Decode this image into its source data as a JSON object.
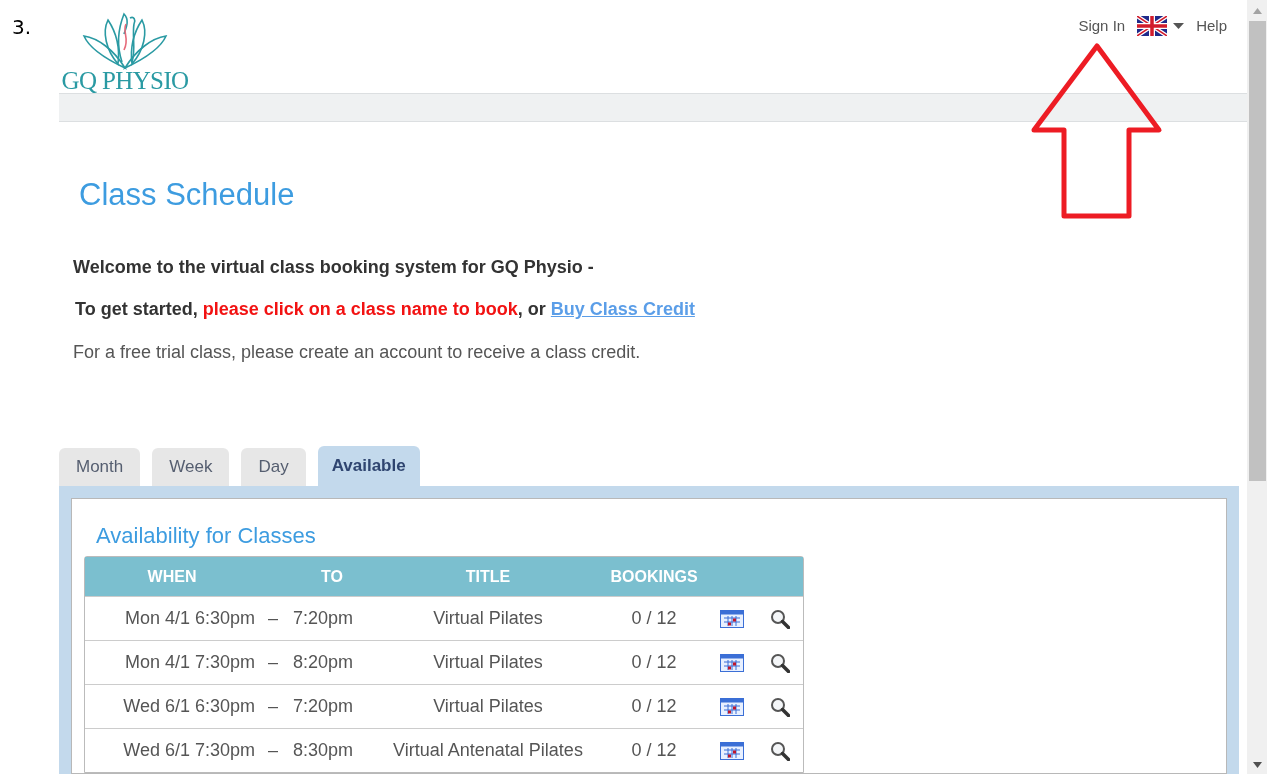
{
  "step_number": "3.",
  "header": {
    "logo_text": "GQ PHYSIO",
    "links": [
      {
        "kind": "link",
        "label": "Sign In"
      },
      {
        "kind": "language"
      },
      {
        "kind": "link",
        "label": "Help"
      }
    ]
  },
  "page_title": "Class Schedule",
  "welcome": "Welcome to the virtual class booking system for GQ Physio -",
  "instructions": {
    "prefix": "To get started, ",
    "highlight": "please click on a class name to book",
    "suffix": ", or ",
    "link": "Buy Class Credit"
  },
  "trial_note": "For a free trial class, please create an account to receive a class credit.",
  "tabs": [
    {
      "label": "Month",
      "selected": false
    },
    {
      "label": "Week",
      "selected": false
    },
    {
      "label": "Day",
      "selected": false
    },
    {
      "label": "Available",
      "selected": true
    }
  ],
  "panel_title": "Availability for Classes",
  "table": {
    "columns": [
      "WHEN",
      "TO",
      "TITLE",
      "BOOKINGS"
    ],
    "rows": [
      {
        "when": "Mon 4/1 6:30pm",
        "separator": "–",
        "to": "7:20pm",
        "title": "Virtual Pilates",
        "bookings": "0 / 12"
      },
      {
        "when": "Mon 4/1 7:30pm",
        "separator": "–",
        "to": "8:20pm",
        "title": "Virtual Pilates",
        "bookings": "0 / 12"
      },
      {
        "when": "Wed 6/1 6:30pm",
        "separator": "–",
        "to": "7:20pm",
        "title": "Virtual Pilates",
        "bookings": "0 / 12"
      },
      {
        "when": "Wed 6/1 7:30pm",
        "separator": "–",
        "to": "8:30pm",
        "title": "Virtual Antenatal Pilates",
        "bookings": "0 / 12"
      }
    ]
  }
}
